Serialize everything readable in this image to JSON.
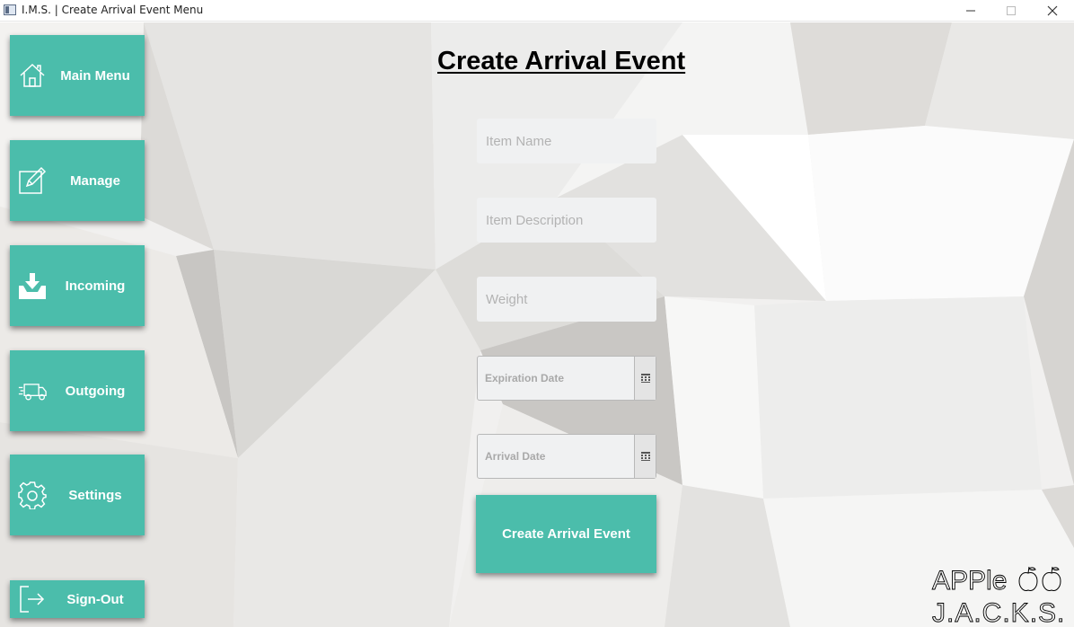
{
  "window": {
    "title": "I.M.S. | Create Arrival Event Menu"
  },
  "sidebar": {
    "items": [
      {
        "label": "Main Menu",
        "icon": "home-icon"
      },
      {
        "label": "Manage",
        "icon": "edit-icon"
      },
      {
        "label": "Incoming",
        "icon": "inbox-download-icon"
      },
      {
        "label": "Outgoing",
        "icon": "delivery-truck-icon"
      },
      {
        "label": "Settings",
        "icon": "gear-icon"
      },
      {
        "label": "Sign-Out",
        "icon": "sign-out-icon"
      }
    ]
  },
  "main": {
    "title": "Create Arrival Event",
    "fields": {
      "item_name": {
        "placeholder": "Item Name",
        "value": ""
      },
      "item_description": {
        "placeholder": "Item Description",
        "value": ""
      },
      "weight": {
        "placeholder": "Weight",
        "value": ""
      },
      "expiration_date": {
        "placeholder": "Expiration Date",
        "value": ""
      },
      "arrival_date": {
        "placeholder": "Arrival Date",
        "value": ""
      }
    },
    "submit_label": "Create Arrival Event"
  },
  "logo": {
    "line1": "APPle",
    "line2": "J.A.C.K.S."
  },
  "colors": {
    "accent": "#4bbdab",
    "field_bg": "#f0f1f2"
  }
}
